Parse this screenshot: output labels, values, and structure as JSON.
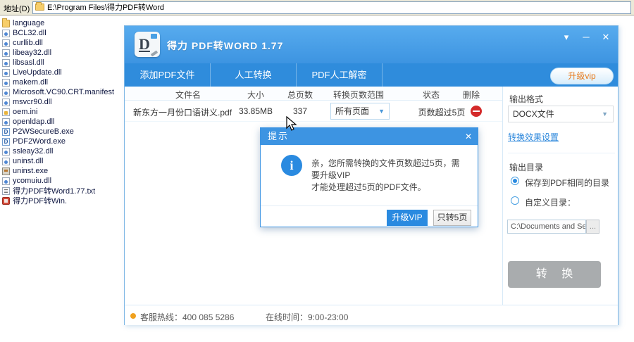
{
  "explorer": {
    "address_label": "地址(D)",
    "address_path": "E:\\Program Files\\得力PDF转Word",
    "files": [
      {
        "name": "language"
      },
      {
        "name": "BCL32.dll"
      },
      {
        "name": "curllib.dll"
      },
      {
        "name": "libeay32.dll"
      },
      {
        "name": "libsasl.dll"
      },
      {
        "name": "LiveUpdate.dll"
      },
      {
        "name": "makem.dll"
      },
      {
        "name": "Microsoft.VC90.CRT.manifest"
      },
      {
        "name": "msvcr90.dll"
      },
      {
        "name": "oem.ini"
      },
      {
        "name": "openldap.dll"
      },
      {
        "name": "P2WSecureB.exe"
      },
      {
        "name": "PDF2Word.exe"
      },
      {
        "name": "ssleay32.dll"
      },
      {
        "name": "uninst.dll"
      },
      {
        "name": "uninst.exe"
      },
      {
        "name": "ycomuiu.dll"
      },
      {
        "name": "得力PDF转Word1.77.txt"
      },
      {
        "name": "得力PDF转Win."
      }
    ]
  },
  "app": {
    "title": "得力 PDF转WORD 1.77",
    "logo_letter": "D",
    "window_controls": {
      "menu": "▾",
      "minimize": "─",
      "close": "✕"
    },
    "tabs": [
      {
        "label": "添加PDF文件"
      },
      {
        "label": "人工转换"
      },
      {
        "label": "PDF人工解密"
      }
    ],
    "vip_button": "升级vip",
    "table": {
      "headers": [
        "文件名",
        "大小",
        "总页数",
        "转换页数范围",
        "状态",
        "删除"
      ],
      "row": {
        "filename": "新东方一月份口语讲义.pdf",
        "size": "33.85MB",
        "pages": "337",
        "range_value": "所有页面",
        "range_arrow": "▼",
        "status": "页数超过5页"
      }
    },
    "right_panel": {
      "output_format_label": "输出格式",
      "format_value": "DOCX文件",
      "format_arrow": "▼",
      "settings_link": "转换效果设置",
      "output_dir_label": "输出目录",
      "radio_same_dir": "保存到PDF相同的目录",
      "radio_custom": "自定义目录：",
      "custom_path": "C:\\Documents and Set",
      "browse_button": "...",
      "convert_button": "转 换"
    },
    "dialog": {
      "title": "提示",
      "close": "✕",
      "info_glyph": "i",
      "message_line1": "亲，您所需转换的文件页数超过5页，需要升级VIP",
      "message_line2": "才能处理超过5页的PDF文件。",
      "upgrade_button": "升级VIP",
      "convert5_button": "只转5页"
    },
    "status_bar": {
      "hotline": "客服热线：400 085 5286",
      "online_time": "在线时间：9:00-23:00"
    }
  },
  "colors": {
    "header_blue": "#3d94e1",
    "tab_blue": "#2f8cdc",
    "accent_blue": "#2a8ae0",
    "link_blue": "#2a86db",
    "delete_red": "#d42a2a",
    "vip_orange": "#e8791a",
    "status_dot_orange": "#f0a11e",
    "disabled_gray": "#a9acae"
  }
}
